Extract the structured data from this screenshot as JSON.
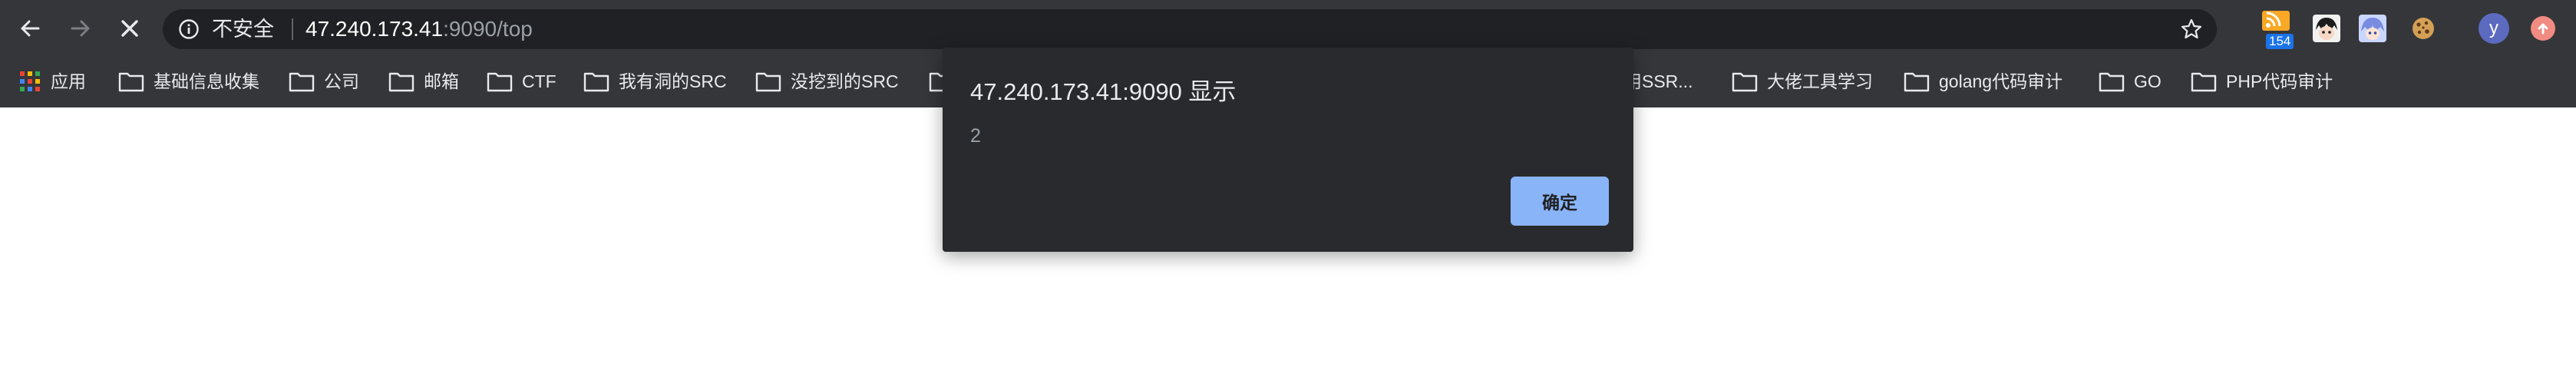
{
  "toolbar": {
    "security_label": "不安全",
    "url_host": "47.240.173.41",
    "url_rest": ":9090/top",
    "rss_badge_count": "154",
    "profile_initial": "y",
    "icons": {
      "back": "back-arrow-icon",
      "forward": "forward-arrow-icon",
      "stop": "stop-loading-icon",
      "info": "info-icon",
      "star": "bookmark-star-icon",
      "rss": "rss-extension-icon",
      "anime_avatar": "anime-avatar-extension-icon",
      "anime_avatar_2": "anime-avatar-2-extension-icon",
      "cookie": "cookie-extension-icon",
      "update": "update-icon"
    }
  },
  "bookmarks": {
    "apps_label": "应用",
    "items": [
      {
        "label": "基础信息收集"
      },
      {
        "label": "公司"
      },
      {
        "label": "邮箱"
      },
      {
        "label": "CTF"
      },
      {
        "label": "我有洞的SRC"
      },
      {
        "label": "没挖到的SRC"
      },
      {
        "label": ""
      },
      {
        "label": "用SSR..."
      },
      {
        "label": "大佬工具学习"
      },
      {
        "label": "golang代码审计"
      },
      {
        "label": "GO"
      },
      {
        "label": "PHP代码审计"
      }
    ]
  },
  "dialog": {
    "title": "47.240.173.41:9090 显示",
    "message": "2",
    "ok_label": "确定"
  },
  "colors": {
    "toolbar_bg": "#35363a",
    "omnibox_bg": "#202124",
    "dialog_bg": "#292a2d",
    "ok_button": "#8ab4f8"
  }
}
